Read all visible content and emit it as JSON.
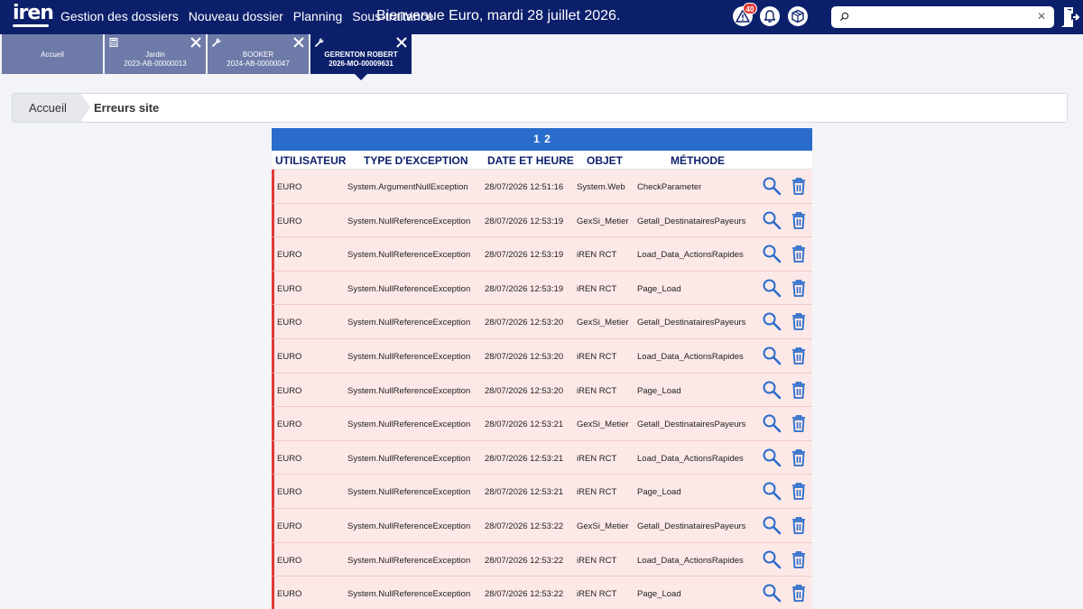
{
  "brand": {
    "logo_text": "iren"
  },
  "nav": [
    {
      "label": "Gestion des dossiers"
    },
    {
      "label": "Nouveau dossier"
    },
    {
      "label": "Planning"
    },
    {
      "label": "Sous-traitance"
    }
  ],
  "welcome": "Bienvenue Euro, mardi 28 juillet 2026.",
  "alerts": {
    "count": "40"
  },
  "search": {
    "value": "",
    "placeholder": ""
  },
  "tabs": [
    {
      "title": "Accueil",
      "subtitle": "",
      "icon": "",
      "active": false
    },
    {
      "title": "Jardin",
      "subtitle": "2023-AB-00000013",
      "icon": "calculator-icon",
      "active": false
    },
    {
      "title": "BOOKER",
      "subtitle": "2024-AB-00000047",
      "icon": "wrench-icon",
      "active": false
    },
    {
      "title": "GERENTON ROBERT",
      "subtitle": "2026-MO-00009631",
      "icon": "wrench-icon",
      "active": true
    }
  ],
  "breadcrumb": {
    "home": "Accueil",
    "current": "Erreurs site"
  },
  "pager": {
    "pages": [
      "1",
      "2"
    ]
  },
  "table": {
    "headers": {
      "user": "UTILISATEUR",
      "type": "TYPE D'EXCEPTION",
      "date": "DATE ET HEURE",
      "object": "OBJET",
      "method": "MÉTHODE"
    },
    "rows": [
      {
        "user": "EURO",
        "type": "System.ArgumentNullException",
        "date": "28/07/2026 12:51:16",
        "object": "System.Web",
        "method": "CheckParameter"
      },
      {
        "user": "EURO",
        "type": "System.NullReferenceException",
        "date": "28/07/2026 12:53:19",
        "object": "GexSi_Metier",
        "method": "Getall_DestinatairesPayeurs"
      },
      {
        "user": "EURO",
        "type": "System.NullReferenceException",
        "date": "28/07/2026 12:53:19",
        "object": "iREN RCT",
        "method": "Load_Data_ActionsRapides"
      },
      {
        "user": "EURO",
        "type": "System.NullReferenceException",
        "date": "28/07/2026 12:53:19",
        "object": "iREN RCT",
        "method": "Page_Load"
      },
      {
        "user": "EURO",
        "type": "System.NullReferenceException",
        "date": "28/07/2026 12:53:20",
        "object": "GexSi_Metier",
        "method": "Getall_DestinatairesPayeurs"
      },
      {
        "user": "EURO",
        "type": "System.NullReferenceException",
        "date": "28/07/2026 12:53:20",
        "object": "iREN RCT",
        "method": "Load_Data_ActionsRapides"
      },
      {
        "user": "EURO",
        "type": "System.NullReferenceException",
        "date": "28/07/2026 12:53:20",
        "object": "iREN RCT",
        "method": "Page_Load"
      },
      {
        "user": "EURO",
        "type": "System.NullReferenceException",
        "date": "28/07/2026 12:53:21",
        "object": "GexSi_Metier",
        "method": "Getall_DestinatairesPayeurs"
      },
      {
        "user": "EURO",
        "type": "System.NullReferenceException",
        "date": "28/07/2026 12:53:21",
        "object": "iREN RCT",
        "method": "Load_Data_ActionsRapides"
      },
      {
        "user": "EURO",
        "type": "System.NullReferenceException",
        "date": "28/07/2026 12:53:21",
        "object": "iREN RCT",
        "method": "Page_Load"
      },
      {
        "user": "EURO",
        "type": "System.NullReferenceException",
        "date": "28/07/2026 12:53:22",
        "object": "GexSi_Metier",
        "method": "Getall_DestinatairesPayeurs"
      },
      {
        "user": "EURO",
        "type": "System.NullReferenceException",
        "date": "28/07/2026 12:53:22",
        "object": "iREN RCT",
        "method": "Load_Data_ActionsRapides"
      },
      {
        "user": "EURO",
        "type": "System.NullReferenceException",
        "date": "28/07/2026 12:53:22",
        "object": "iREN RCT",
        "method": "Page_Load"
      }
    ]
  },
  "colors": {
    "topbar": "#0c1f6b",
    "pager": "#2a6ccb",
    "row_background": "#fde8e8",
    "row_accent": "#e03a3a",
    "action_icon": "#2a6ccb"
  }
}
